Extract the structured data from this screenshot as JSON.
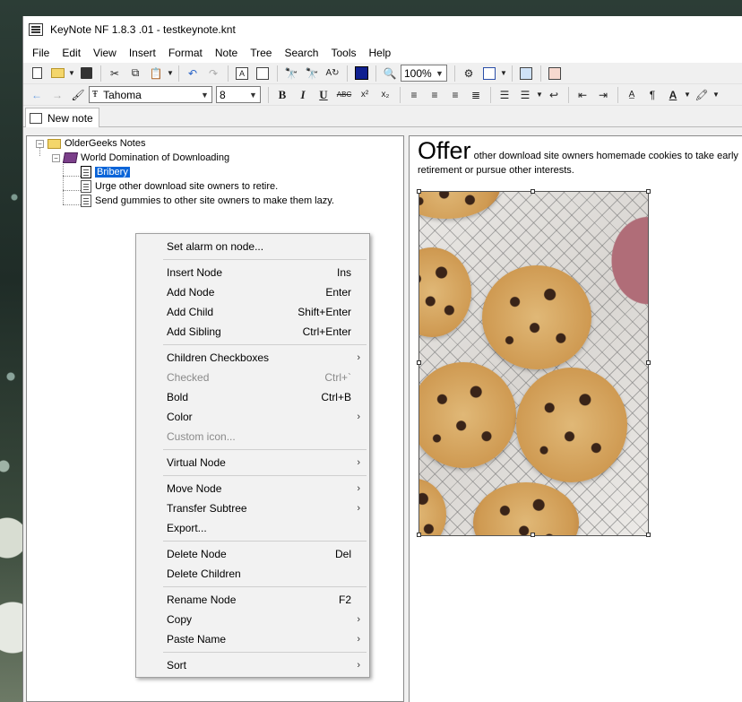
{
  "window": {
    "title": "KeyNote NF  1.8.3 .01 - testkeynote.knt",
    "icon": "keynote-app-icon"
  },
  "menu": [
    "File",
    "Edit",
    "View",
    "Insert",
    "Format",
    "Note",
    "Tree",
    "Search",
    "Tools",
    "Help"
  ],
  "toolbar": {
    "zoom": "100%",
    "font_name": "Tahoma",
    "font_size": "8",
    "bold": "B",
    "italic": "I",
    "underline": "U",
    "strike": "ABC",
    "superscript": "x²",
    "subscript": "x₂"
  },
  "tabs": [
    {
      "label": "New note"
    }
  ],
  "tree": {
    "nodes": [
      {
        "label": "OlderGeeks Notes",
        "icon": "folder-icon"
      },
      {
        "label": "World Domination of Downloading",
        "icon": "book-icon"
      },
      {
        "label": "Bribery",
        "icon": "note-icon",
        "selected": true
      },
      {
        "label": "Urge other download site owners to retire.",
        "icon": "note-icon"
      },
      {
        "label": "Send gummies to other site owners to make them lazy.",
        "icon": "note-icon"
      }
    ]
  },
  "editor": {
    "heading_word": "Offer",
    "body_text": "other download site owners homemade cookies to take early retirement or pursue other interests.",
    "image": "chocolate-chip-cookies-photo"
  },
  "context_menu": {
    "items": [
      {
        "label": "Set alarm on node...",
        "shortcut": "",
        "submenu": false,
        "disabled": false
      },
      {
        "sep": true
      },
      {
        "label": "Insert Node",
        "shortcut": "Ins",
        "submenu": false,
        "disabled": false
      },
      {
        "label": "Add Node",
        "shortcut": "Enter",
        "submenu": false,
        "disabled": false
      },
      {
        "label": "Add Child",
        "shortcut": "Shift+Enter",
        "submenu": false,
        "disabled": false
      },
      {
        "label": "Add Sibling",
        "shortcut": "Ctrl+Enter",
        "submenu": false,
        "disabled": false
      },
      {
        "sep": true
      },
      {
        "label": "Children Checkboxes",
        "shortcut": "",
        "submenu": true,
        "disabled": false
      },
      {
        "label": "Checked",
        "shortcut": "Ctrl+`",
        "submenu": false,
        "disabled": true
      },
      {
        "label": "Bold",
        "shortcut": "Ctrl+B",
        "submenu": false,
        "disabled": false
      },
      {
        "label": "Color",
        "shortcut": "",
        "submenu": true,
        "disabled": false
      },
      {
        "label": "Custom icon...",
        "shortcut": "",
        "submenu": false,
        "disabled": true
      },
      {
        "sep": true
      },
      {
        "label": "Virtual Node",
        "shortcut": "",
        "submenu": true,
        "disabled": false
      },
      {
        "sep": true
      },
      {
        "label": "Move Node",
        "shortcut": "",
        "submenu": true,
        "disabled": false
      },
      {
        "label": "Transfer Subtree",
        "shortcut": "",
        "submenu": true,
        "disabled": false
      },
      {
        "label": "Export...",
        "shortcut": "",
        "submenu": false,
        "disabled": false
      },
      {
        "sep": true
      },
      {
        "label": "Delete Node",
        "shortcut": "Del",
        "submenu": false,
        "disabled": false
      },
      {
        "label": "Delete Children",
        "shortcut": "",
        "submenu": false,
        "disabled": false
      },
      {
        "sep": true
      },
      {
        "label": "Rename Node",
        "shortcut": "F2",
        "submenu": false,
        "disabled": false
      },
      {
        "label": "Copy",
        "shortcut": "",
        "submenu": true,
        "disabled": false
      },
      {
        "label": "Paste Name",
        "shortcut": "",
        "submenu": true,
        "disabled": false
      },
      {
        "sep": true
      },
      {
        "label": "Sort",
        "shortcut": "",
        "submenu": true,
        "disabled": false
      }
    ]
  },
  "colors": {
    "selection": "#0a64d8",
    "window_bg": "#f0f0f0"
  }
}
